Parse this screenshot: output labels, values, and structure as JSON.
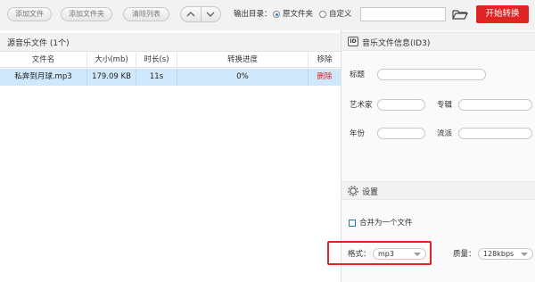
{
  "toolbar": {
    "add_file": "添加文件",
    "add_folder": "添加文件夹",
    "clear_list": "清除列表",
    "output_label": "输出目录：",
    "option_source": "原文件夹",
    "option_custom": "自定义",
    "output_path": "",
    "start_button": "开始转换"
  },
  "list": {
    "header": "源音乐文件 (1个)",
    "columns": [
      "文件名",
      "大小(mb)",
      "时长(s)",
      "转换进度",
      "移除"
    ],
    "rows": [
      {
        "name": "私奔到月球.mp3",
        "size": "179.09 KB",
        "duration": "11s",
        "progress": "0%",
        "remove": "删除"
      }
    ]
  },
  "id3": {
    "header": "音乐文件信息(ID3)",
    "badge": "ID",
    "title_label": "标题",
    "artist_label": "艺术家",
    "album_label": "专辑",
    "year_label": "年份",
    "genre_label": "流派"
  },
  "settings": {
    "header": "设置",
    "merge_label": "合并为一个文件",
    "merge_checked": false,
    "format_label": "格式：",
    "format_value": "mp3",
    "quality_label": "质量：",
    "quality_value": "128kbps"
  },
  "colors": {
    "accent": "#e02424",
    "selection": "#cfe8fb",
    "radio": "#2a7ad8"
  }
}
